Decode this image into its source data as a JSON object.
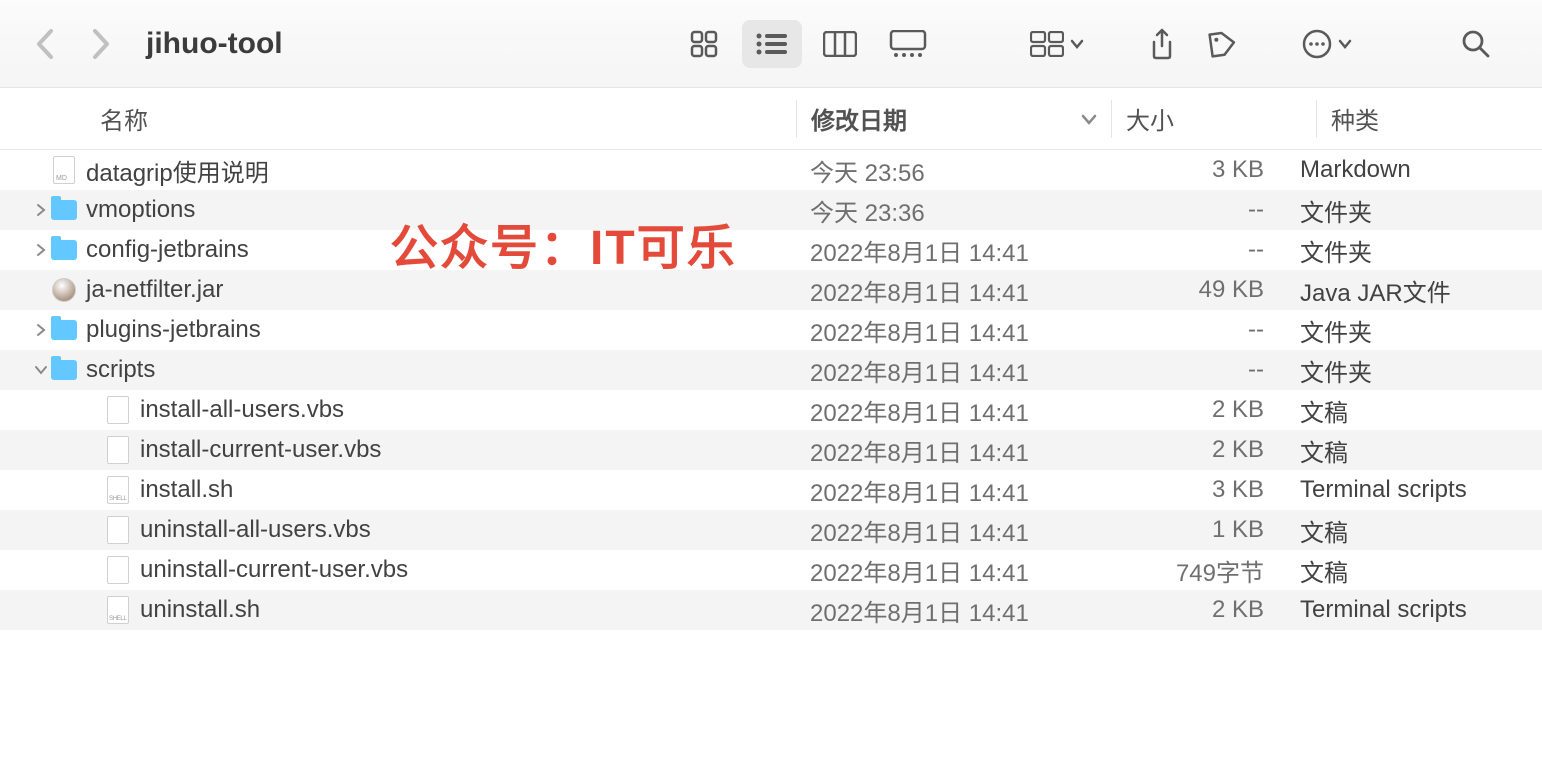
{
  "toolbar": {
    "title": "jihuo-tool"
  },
  "columns": {
    "name": "名称",
    "date": "修改日期",
    "size": "大小",
    "kind": "种类"
  },
  "watermark": "公众号：IT可乐",
  "rows": [
    {
      "indent": 0,
      "disclosure": "",
      "icon": "md",
      "name": "datagrip使用说明",
      "date": "今天 23:56",
      "size": "3 KB",
      "kind": "Markdown"
    },
    {
      "indent": 0,
      "disclosure": "right",
      "icon": "folder",
      "name": "vmoptions",
      "date": "今天 23:36",
      "size": "--",
      "kind": "文件夹"
    },
    {
      "indent": 0,
      "disclosure": "right",
      "icon": "folder",
      "name": "config-jetbrains",
      "date": "2022年8月1日 14:41",
      "size": "--",
      "kind": "文件夹"
    },
    {
      "indent": 0,
      "disclosure": "",
      "icon": "jar",
      "name": "ja-netfilter.jar",
      "date": "2022年8月1日 14:41",
      "size": "49 KB",
      "kind": "Java JAR文件"
    },
    {
      "indent": 0,
      "disclosure": "right",
      "icon": "folder",
      "name": "plugins-jetbrains",
      "date": "2022年8月1日 14:41",
      "size": "--",
      "kind": "文件夹"
    },
    {
      "indent": 0,
      "disclosure": "down",
      "icon": "folder",
      "name": "scripts",
      "date": "2022年8月1日 14:41",
      "size": "--",
      "kind": "文件夹"
    },
    {
      "indent": 1,
      "disclosure": "",
      "icon": "file",
      "name": "install-all-users.vbs",
      "date": "2022年8月1日 14:41",
      "size": "2 KB",
      "kind": "文稿"
    },
    {
      "indent": 1,
      "disclosure": "",
      "icon": "file",
      "name": "install-current-user.vbs",
      "date": "2022年8月1日 14:41",
      "size": "2 KB",
      "kind": "文稿"
    },
    {
      "indent": 1,
      "disclosure": "",
      "icon": "shell",
      "name": "install.sh",
      "date": "2022年8月1日 14:41",
      "size": "3 KB",
      "kind": "Terminal scripts"
    },
    {
      "indent": 1,
      "disclosure": "",
      "icon": "file",
      "name": "uninstall-all-users.vbs",
      "date": "2022年8月1日 14:41",
      "size": "1 KB",
      "kind": "文稿"
    },
    {
      "indent": 1,
      "disclosure": "",
      "icon": "file",
      "name": "uninstall-current-user.vbs",
      "date": "2022年8月1日 14:41",
      "size": "749字节",
      "kind": "文稿"
    },
    {
      "indent": 1,
      "disclosure": "",
      "icon": "shell",
      "name": "uninstall.sh",
      "date": "2022年8月1日 14:41",
      "size": "2 KB",
      "kind": "Terminal scripts"
    }
  ]
}
